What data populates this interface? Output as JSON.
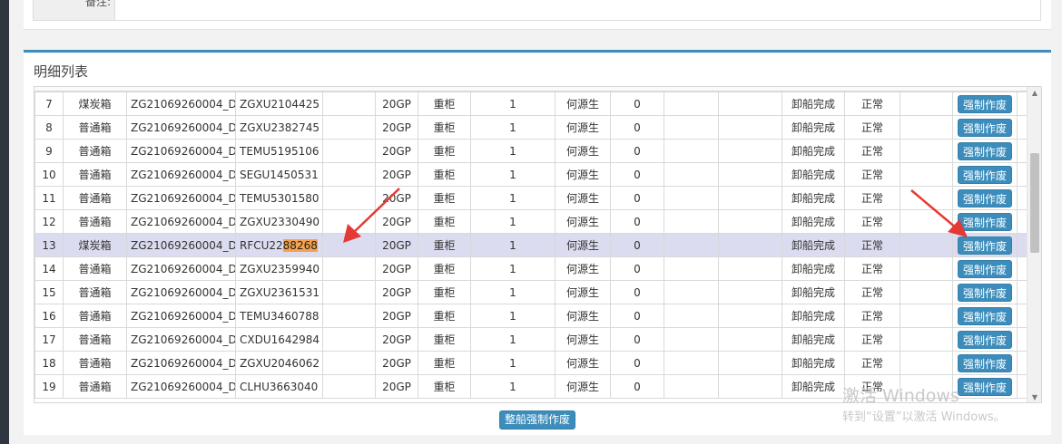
{
  "top_form": {
    "remark_label": "备注:",
    "remark_value": ""
  },
  "panel": {
    "title": "明细列表",
    "bulk_button": "整船强制作废"
  },
  "rows": [
    {
      "no": "7",
      "type": "煤炭箱",
      "ref": "ZG21069260004_D",
      "container_prefix": "ZGXU2104425",
      "container_highlight": "",
      "blank1": "",
      "size": "20GP",
      "load": "重柜",
      "qty": "1",
      "person": "何源生",
      "zero": "0",
      "blank2": "",
      "blank3": "",
      "status": "卸船完成",
      "cond": "正常",
      "blank4": "",
      "action": "强制作废"
    },
    {
      "no": "8",
      "type": "普通箱",
      "ref": "ZG21069260004_D",
      "container_prefix": "ZGXU2382745",
      "container_highlight": "",
      "blank1": "",
      "size": "20GP",
      "load": "重柜",
      "qty": "1",
      "person": "何源生",
      "zero": "0",
      "blank2": "",
      "blank3": "",
      "status": "卸船完成",
      "cond": "正常",
      "blank4": "",
      "action": "强制作废"
    },
    {
      "no": "9",
      "type": "普通箱",
      "ref": "ZG21069260004_D",
      "container_prefix": "TEMU5195106",
      "container_highlight": "",
      "blank1": "",
      "size": "20GP",
      "load": "重柜",
      "qty": "1",
      "person": "何源生",
      "zero": "0",
      "blank2": "",
      "blank3": "",
      "status": "卸船完成",
      "cond": "正常",
      "blank4": "",
      "action": "强制作废"
    },
    {
      "no": "10",
      "type": "普通箱",
      "ref": "ZG21069260004_D",
      "container_prefix": "SEGU1450531",
      "container_highlight": "",
      "blank1": "",
      "size": "20GP",
      "load": "重柜",
      "qty": "1",
      "person": "何源生",
      "zero": "0",
      "blank2": "",
      "blank3": "",
      "status": "卸船完成",
      "cond": "正常",
      "blank4": "",
      "action": "强制作废"
    },
    {
      "no": "11",
      "type": "普通箱",
      "ref": "ZG21069260004_D",
      "container_prefix": "TEMU5301580",
      "container_highlight": "",
      "blank1": "",
      "size": "20GP",
      "load": "重柜",
      "qty": "1",
      "person": "何源生",
      "zero": "0",
      "blank2": "",
      "blank3": "",
      "status": "卸船完成",
      "cond": "正常",
      "blank4": "",
      "action": "强制作废"
    },
    {
      "no": "12",
      "type": "普通箱",
      "ref": "ZG21069260004_D",
      "container_prefix": "ZGXU2330490",
      "container_highlight": "",
      "blank1": "",
      "size": "20GP",
      "load": "重柜",
      "qty": "1",
      "person": "何源生",
      "zero": "0",
      "blank2": "",
      "blank3": "",
      "status": "卸船完成",
      "cond": "正常",
      "blank4": "",
      "action": "强制作废"
    },
    {
      "no": "13",
      "type": "煤炭箱",
      "ref": "ZG21069260004_D",
      "container_prefix": "RFCU22",
      "container_highlight": "88268",
      "blank1": "",
      "size": "20GP",
      "load": "重柜",
      "qty": "1",
      "person": "何源生",
      "zero": "0",
      "blank2": "",
      "blank3": "",
      "status": "卸船完成",
      "cond": "正常",
      "blank4": "",
      "action": "强制作废",
      "highlighted": true
    },
    {
      "no": "14",
      "type": "普通箱",
      "ref": "ZG21069260004_D",
      "container_prefix": "ZGXU2359940",
      "container_highlight": "",
      "blank1": "",
      "size": "20GP",
      "load": "重柜",
      "qty": "1",
      "person": "何源生",
      "zero": "0",
      "blank2": "",
      "blank3": "",
      "status": "卸船完成",
      "cond": "正常",
      "blank4": "",
      "action": "强制作废"
    },
    {
      "no": "15",
      "type": "普通箱",
      "ref": "ZG21069260004_D",
      "container_prefix": "ZGXU2361531",
      "container_highlight": "",
      "blank1": "",
      "size": "20GP",
      "load": "重柜",
      "qty": "1",
      "person": "何源生",
      "zero": "0",
      "blank2": "",
      "blank3": "",
      "status": "卸船完成",
      "cond": "正常",
      "blank4": "",
      "action": "强制作废"
    },
    {
      "no": "16",
      "type": "普通箱",
      "ref": "ZG21069260004_D",
      "container_prefix": "TEMU3460788",
      "container_highlight": "",
      "blank1": "",
      "size": "20GP",
      "load": "重柜",
      "qty": "1",
      "person": "何源生",
      "zero": "0",
      "blank2": "",
      "blank3": "",
      "status": "卸船完成",
      "cond": "正常",
      "blank4": "",
      "action": "强制作废"
    },
    {
      "no": "17",
      "type": "普通箱",
      "ref": "ZG21069260004_D",
      "container_prefix": "CXDU1642984",
      "container_highlight": "",
      "blank1": "",
      "size": "20GP",
      "load": "重柜",
      "qty": "1",
      "person": "何源生",
      "zero": "0",
      "blank2": "",
      "blank3": "",
      "status": "卸船完成",
      "cond": "正常",
      "blank4": "",
      "action": "强制作废"
    },
    {
      "no": "18",
      "type": "普通箱",
      "ref": "ZG21069260004_D",
      "container_prefix": "ZGXU2046062",
      "container_highlight": "",
      "blank1": "",
      "size": "20GP",
      "load": "重柜",
      "qty": "1",
      "person": "何源生",
      "zero": "0",
      "blank2": "",
      "blank3": "",
      "status": "卸船完成",
      "cond": "正常",
      "blank4": "",
      "action": "强制作废"
    },
    {
      "no": "19",
      "type": "普通箱",
      "ref": "ZG21069260004_D",
      "container_prefix": "CLHU3663040",
      "container_highlight": "",
      "blank1": "",
      "size": "20GP",
      "load": "重柜",
      "qty": "1",
      "person": "何源生",
      "zero": "0",
      "blank2": "",
      "blank3": "",
      "status": "卸船完成",
      "cond": "正常",
      "blank4": "",
      "action": "强制作废"
    }
  ],
  "colors": {
    "accent": "#3c8dbc",
    "status_done": "#e7c31e",
    "row_highlight": "#dcdcf0",
    "text_highlight": "#f7a24d",
    "annotation_arrow": "#e53935"
  },
  "watermark": {
    "title": "激活 Windows",
    "subtitle": "转到“设置”以激活 Windows。"
  }
}
